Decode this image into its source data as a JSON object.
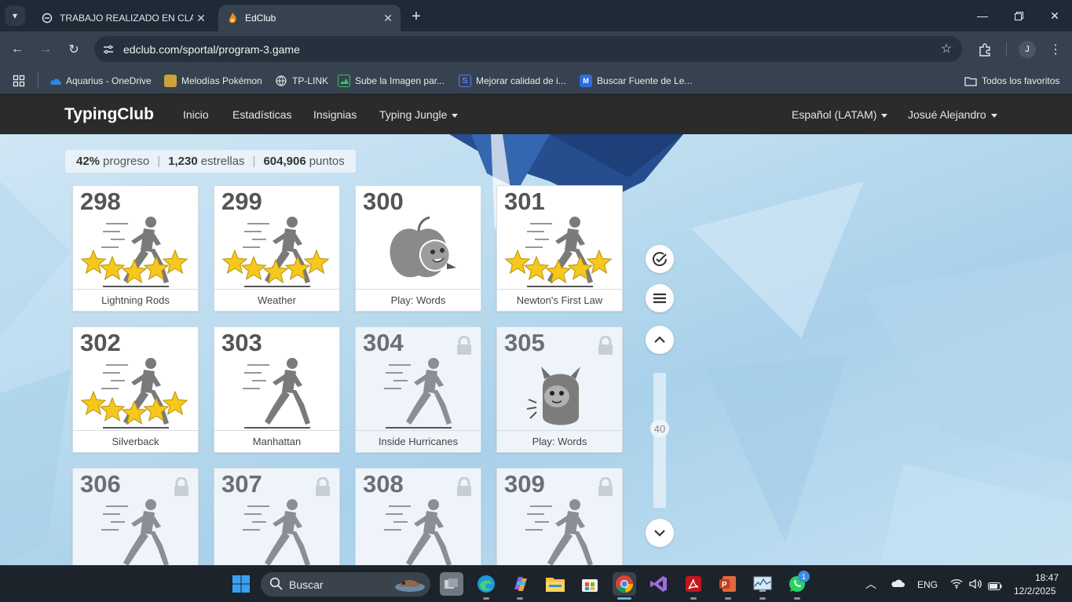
{
  "browser": {
    "tabs": [
      {
        "title": "TRABAJO REALIZADO EN CLASE",
        "active": false
      },
      {
        "title": "EdClub",
        "active": true
      }
    ],
    "url": "edclub.com/sportal/program-3.game",
    "profile_initial": "J",
    "bookmarks": [
      {
        "label": "Aquarius - OneDrive",
        "icon": "onedrive-icon"
      },
      {
        "label": "Melodías Pokémon",
        "icon": "pokemon-icon"
      },
      {
        "label": "TP-LINK",
        "icon": "globe-icon"
      },
      {
        "label": "Sube la Imagen par...",
        "icon": "image-upload-icon"
      },
      {
        "label": "Mejorar calidad de i...",
        "icon": "enhance-icon"
      },
      {
        "label": "Buscar Fuente de Le...",
        "icon": "font-search-icon"
      }
    ],
    "all_bookmarks": "Todos los favoritos"
  },
  "navbar": {
    "brand": "TypingClub",
    "links": [
      "Inicio",
      "Estadísticas",
      "Insignias",
      "Typing Jungle"
    ],
    "language": "Español (LATAM)",
    "user": "Josué Alejandro"
  },
  "progress": {
    "percent": "42%",
    "percent_label": "progreso",
    "stars": "1,230",
    "stars_label": "estrellas",
    "points": "604,906",
    "points_label": "puntos"
  },
  "lessons": [
    {
      "number": "298",
      "name": "Lightning Rods",
      "stars": 5,
      "locked": false,
      "kind": "runner"
    },
    {
      "number": "299",
      "name": "Weather",
      "stars": 5,
      "locked": false,
      "kind": "runner"
    },
    {
      "number": "300",
      "name": "Play: Words",
      "stars": 0,
      "locked": false,
      "kind": "game-apple"
    },
    {
      "number": "301",
      "name": "Newton's First Law",
      "stars": 5,
      "locked": false,
      "kind": "runner"
    },
    {
      "number": "302",
      "name": "Silverback",
      "stars": 5,
      "locked": false,
      "kind": "runner"
    },
    {
      "number": "303",
      "name": "Manhattan",
      "stars": 0,
      "locked": false,
      "kind": "runner"
    },
    {
      "number": "304",
      "name": "Inside Hurricanes",
      "stars": 0,
      "locked": true,
      "kind": "runner"
    },
    {
      "number": "305",
      "name": "Play: Words",
      "stars": 0,
      "locked": true,
      "kind": "game-monster"
    },
    {
      "number": "306",
      "name": "",
      "stars": 0,
      "locked": true,
      "kind": "runner"
    },
    {
      "number": "307",
      "name": "",
      "stars": 0,
      "locked": true,
      "kind": "runner"
    },
    {
      "number": "308",
      "name": "",
      "stars": 0,
      "locked": true,
      "kind": "runner"
    },
    {
      "number": "309",
      "name": "",
      "stars": 0,
      "locked": true,
      "kind": "runner"
    }
  ],
  "side_controls": {
    "slider_value": "40"
  },
  "taskbar": {
    "search": "Buscar",
    "notification_count": "1",
    "language": "ENG",
    "time": "18:47",
    "date": "12/2/2025"
  },
  "colors": {
    "navbar": "#2b2b2b",
    "star": "#f6c81c",
    "accent_blue": "#a9d1ea"
  }
}
